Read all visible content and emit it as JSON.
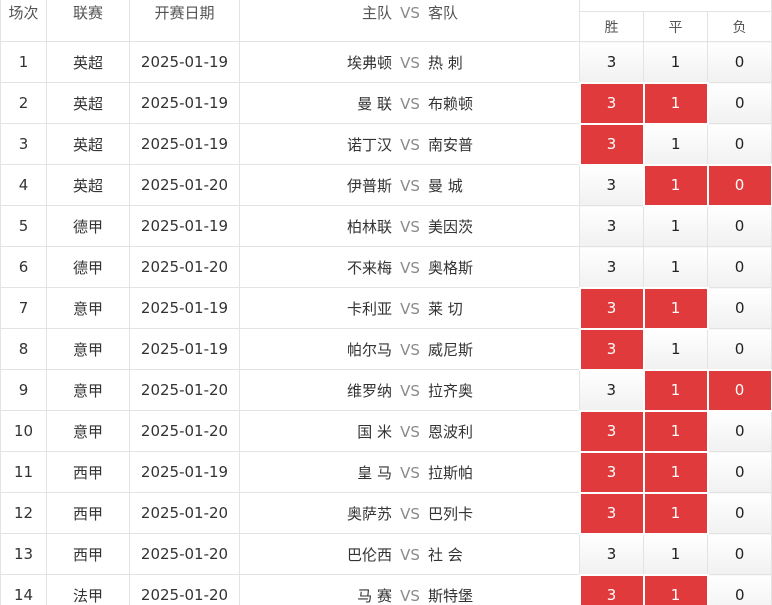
{
  "header": {
    "col_no": "场次",
    "col_league": "联赛",
    "col_date": "开赛日期",
    "col_home": "主队",
    "col_vs": "VS",
    "col_away": "客队",
    "odds_win": "胜",
    "odds_draw": "平",
    "odds_lose": "负"
  },
  "colors": {
    "selected": "#e03a3c",
    "border": "#e3e3e3"
  },
  "rows": [
    {
      "no": "1",
      "league": "英超",
      "date": "2025-01-19",
      "home": "埃弗顿",
      "vs": "VS",
      "away": "热 刺",
      "win": "3",
      "draw": "1",
      "lose": "0",
      "win_sel": false,
      "draw_sel": false,
      "lose_sel": false
    },
    {
      "no": "2",
      "league": "英超",
      "date": "2025-01-19",
      "home": "曼 联",
      "vs": "VS",
      "away": "布赖顿",
      "win": "3",
      "draw": "1",
      "lose": "0",
      "win_sel": true,
      "draw_sel": true,
      "lose_sel": false
    },
    {
      "no": "3",
      "league": "英超",
      "date": "2025-01-19",
      "home": "诺丁汉",
      "vs": "VS",
      "away": "南安普",
      "win": "3",
      "draw": "1",
      "lose": "0",
      "win_sel": true,
      "draw_sel": false,
      "lose_sel": false
    },
    {
      "no": "4",
      "league": "英超",
      "date": "2025-01-20",
      "home": "伊普斯",
      "vs": "VS",
      "away": "曼 城",
      "win": "3",
      "draw": "1",
      "lose": "0",
      "win_sel": false,
      "draw_sel": true,
      "lose_sel": true
    },
    {
      "no": "5",
      "league": "德甲",
      "date": "2025-01-19",
      "home": "柏林联",
      "vs": "VS",
      "away": "美因茨",
      "win": "3",
      "draw": "1",
      "lose": "0",
      "win_sel": false,
      "draw_sel": false,
      "lose_sel": false
    },
    {
      "no": "6",
      "league": "德甲",
      "date": "2025-01-20",
      "home": "不来梅",
      "vs": "VS",
      "away": "奥格斯",
      "win": "3",
      "draw": "1",
      "lose": "0",
      "win_sel": false,
      "draw_sel": false,
      "lose_sel": false
    },
    {
      "no": "7",
      "league": "意甲",
      "date": "2025-01-19",
      "home": "卡利亚",
      "vs": "VS",
      "away": "莱 切",
      "win": "3",
      "draw": "1",
      "lose": "0",
      "win_sel": true,
      "draw_sel": true,
      "lose_sel": false
    },
    {
      "no": "8",
      "league": "意甲",
      "date": "2025-01-19",
      "home": "帕尔马",
      "vs": "VS",
      "away": "威尼斯",
      "win": "3",
      "draw": "1",
      "lose": "0",
      "win_sel": true,
      "draw_sel": false,
      "lose_sel": false
    },
    {
      "no": "9",
      "league": "意甲",
      "date": "2025-01-20",
      "home": "维罗纳",
      "vs": "VS",
      "away": "拉齐奥",
      "win": "3",
      "draw": "1",
      "lose": "0",
      "win_sel": false,
      "draw_sel": true,
      "lose_sel": true
    },
    {
      "no": "10",
      "league": "意甲",
      "date": "2025-01-20",
      "home": "国 米",
      "vs": "VS",
      "away": "恩波利",
      "win": "3",
      "draw": "1",
      "lose": "0",
      "win_sel": true,
      "draw_sel": true,
      "lose_sel": false
    },
    {
      "no": "11",
      "league": "西甲",
      "date": "2025-01-19",
      "home": "皇 马",
      "vs": "VS",
      "away": "拉斯帕",
      "win": "3",
      "draw": "1",
      "lose": "0",
      "win_sel": true,
      "draw_sel": true,
      "lose_sel": false
    },
    {
      "no": "12",
      "league": "西甲",
      "date": "2025-01-20",
      "home": "奥萨苏",
      "vs": "VS",
      "away": "巴列卡",
      "win": "3",
      "draw": "1",
      "lose": "0",
      "win_sel": true,
      "draw_sel": true,
      "lose_sel": false
    },
    {
      "no": "13",
      "league": "西甲",
      "date": "2025-01-20",
      "home": "巴伦西",
      "vs": "VS",
      "away": "社 会",
      "win": "3",
      "draw": "1",
      "lose": "0",
      "win_sel": false,
      "draw_sel": false,
      "lose_sel": false
    },
    {
      "no": "14",
      "league": "法甲",
      "date": "2025-01-20",
      "home": "马 赛",
      "vs": "VS",
      "away": "斯特堡",
      "win": "3",
      "draw": "1",
      "lose": "0",
      "win_sel": true,
      "draw_sel": true,
      "lose_sel": false
    }
  ]
}
